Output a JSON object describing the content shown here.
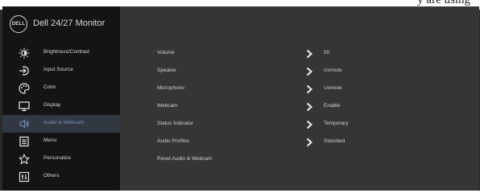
{
  "top_cutoff_text": "y are using",
  "osd": {
    "model_name": "Dell 24/27 Monitor",
    "logo_text": "DELL",
    "sidebar": {
      "items": [
        {
          "label": "Brightness/Contrast",
          "icon": "sun-icon"
        },
        {
          "label": "Input Source",
          "icon": "input-source-icon"
        },
        {
          "label": "Color",
          "icon": "palette-icon"
        },
        {
          "label": "Display",
          "icon": "display-icon"
        },
        {
          "label": "Audio & Webcam",
          "icon": "speaker-icon"
        },
        {
          "label": "Menu",
          "icon": "menu-icon"
        },
        {
          "label": "Personalize",
          "icon": "star-icon"
        },
        {
          "label": "Others",
          "icon": "others-icon"
        }
      ],
      "active_index": 4,
      "active_color": "#7b93b8"
    },
    "rows": [
      {
        "label": "Volume",
        "value": "50",
        "has_chevron": true
      },
      {
        "label": "Speaker",
        "value": "Unmute",
        "has_chevron": true
      },
      {
        "label": "Microphone",
        "value": "Unmute",
        "has_chevron": true
      },
      {
        "label": "Webcam",
        "value": "Enable",
        "has_chevron": true
      },
      {
        "label": "Status Indicator",
        "value": "Temporary",
        "has_chevron": true
      },
      {
        "label": "Audio Profiles",
        "value": "Standard",
        "has_chevron": true
      },
      {
        "label": "Reset Audio & Webcam",
        "value": "",
        "has_chevron": false
      }
    ]
  }
}
